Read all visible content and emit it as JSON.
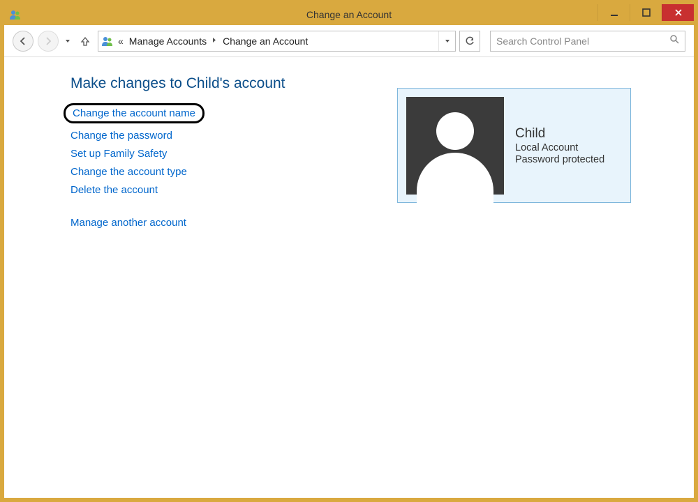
{
  "window": {
    "title": "Change an Account"
  },
  "breadcrumb": {
    "prefix": "«",
    "items": [
      "Manage Accounts",
      "Change an Account"
    ]
  },
  "search": {
    "placeholder": "Search Control Panel"
  },
  "page": {
    "heading": "Make changes to Child's account",
    "links": {
      "change_name": "Change the account name",
      "change_password": "Change the password",
      "family_safety": "Set up Family Safety",
      "change_type": "Change the account type",
      "delete": "Delete the account",
      "manage_another": "Manage another account"
    }
  },
  "account": {
    "name": "Child",
    "type": "Local Account",
    "status": "Password protected"
  }
}
